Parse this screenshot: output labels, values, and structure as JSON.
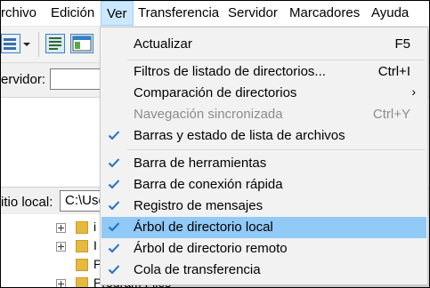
{
  "menubar": {
    "items": [
      "rchivo",
      "Edición",
      "Ver",
      "Transferencia",
      "Servidor",
      "Marcadores",
      "Ayuda"
    ]
  },
  "quickconnect": {
    "server_label": "ervidor:"
  },
  "local_site": {
    "label": "itio local:",
    "path": "C:\\Use"
  },
  "tree": {
    "items": [
      "i",
      "I",
      "P",
      "",
      "Program Files"
    ]
  },
  "view_menu": {
    "items": [
      {
        "label": "Actualizar",
        "shortcut": "F5",
        "checked": false,
        "enabled": true
      },
      {
        "label": "Filtros de listado de directorios...",
        "shortcut": "Ctrl+I",
        "checked": false,
        "enabled": true
      },
      {
        "label": "Comparación de directorios",
        "submenu_arrow": "›",
        "checked": false,
        "enabled": true
      },
      {
        "label": "Navegación sincronizada",
        "shortcut": "Ctrl+Y",
        "checked": false,
        "enabled": false
      },
      {
        "label": "Barras y estado de lista de archivos",
        "checked": true,
        "enabled": true
      },
      {
        "label": "Barra de herramientas",
        "checked": true,
        "enabled": true
      },
      {
        "label": "Barra de conexión rápida",
        "checked": true,
        "enabled": true
      },
      {
        "label": "Registro de mensajes",
        "checked": true,
        "enabled": true
      },
      {
        "label": "Árbol de directorio local",
        "checked": true,
        "enabled": true,
        "highlighted": true
      },
      {
        "label": "Árbol de directorio remoto",
        "checked": true,
        "enabled": true
      },
      {
        "label": "Cola de transferencia",
        "checked": true,
        "enabled": true
      }
    ]
  },
  "colors": {
    "check": "#1a6fc9",
    "highlight": "#91c9f7",
    "active_menu": "#cce8ff"
  }
}
